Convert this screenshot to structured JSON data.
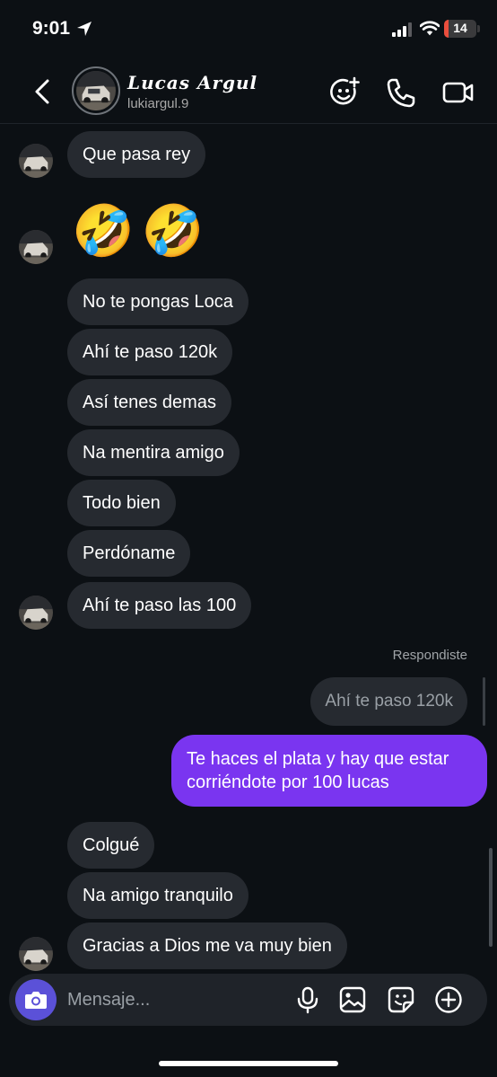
{
  "status_bar": {
    "time": "9:01",
    "battery_level": "14",
    "battery_color": "#eb4e3d"
  },
  "header": {
    "contact_name": "Lucas Argul",
    "contact_username": "lukiargul.9",
    "icons": [
      "back-icon",
      "sticker-face-add-icon",
      "phone-icon",
      "video-camera-icon"
    ]
  },
  "messages": {
    "incoming": [
      "Que pasa rey",
      "🤣",
      "🤣",
      "No te pongas Loca",
      "Ahí te paso 120k",
      "Así tenes demas",
      "Na mentira amigo",
      "Todo bien",
      "Perdóname",
      "Ahí te paso las 100"
    ],
    "reply_label": "Respondiste",
    "replied_to": "Ahí te paso 120k",
    "outgoing": "Te haces el plata y hay que estar corriéndote por 100 lucas",
    "incoming_after": [
      "Colgué",
      "Na amigo tranquilo",
      "Gracias a Dios me va muy bien"
    ]
  },
  "composer": {
    "placeholder": "Mensaje...",
    "icons": [
      "camera-icon",
      "microphone-icon",
      "gallery-icon",
      "sticker-icon",
      "plus-icon"
    ]
  },
  "colors": {
    "background": "#0c1014",
    "incoming_bubble": "#262a30",
    "outgoing_bubble": "#7a35f0",
    "camera_button": "#5b51d8"
  }
}
